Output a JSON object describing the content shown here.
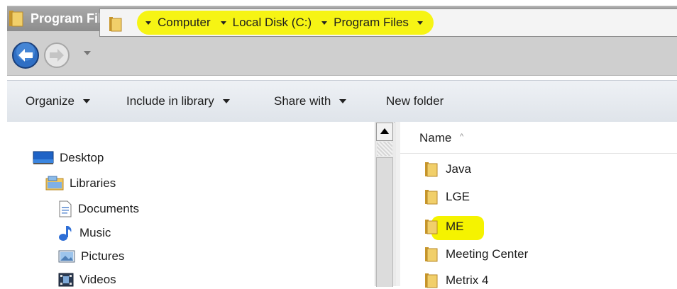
{
  "window": {
    "title": "Program Files"
  },
  "address": {
    "crumbs": [
      "Computer",
      "Local Disk (C:)",
      "Program Files"
    ]
  },
  "toolbar": {
    "organize": "Organize",
    "include": "Include in library",
    "share": "Share with",
    "new_folder": "New folder"
  },
  "nav": {
    "items": [
      {
        "label": "Desktop",
        "icon": "desktop-icon"
      },
      {
        "label": "Libraries",
        "icon": "libraries-icon"
      },
      {
        "label": "Documents",
        "icon": "documents-icon"
      },
      {
        "label": "Music",
        "icon": "music-icon"
      },
      {
        "label": "Pictures",
        "icon": "pictures-icon"
      },
      {
        "label": "Videos",
        "icon": "videos-icon"
      }
    ]
  },
  "files": {
    "column_name": "Name",
    "sort_glyph": "^",
    "items": [
      "Java",
      "LGE",
      "ME",
      "Meeting Center",
      "Metrix 4"
    ]
  },
  "colors": {
    "highlight": "#f5f300",
    "titlebar": "#9a9a9a",
    "folder": "#e8c35a"
  }
}
